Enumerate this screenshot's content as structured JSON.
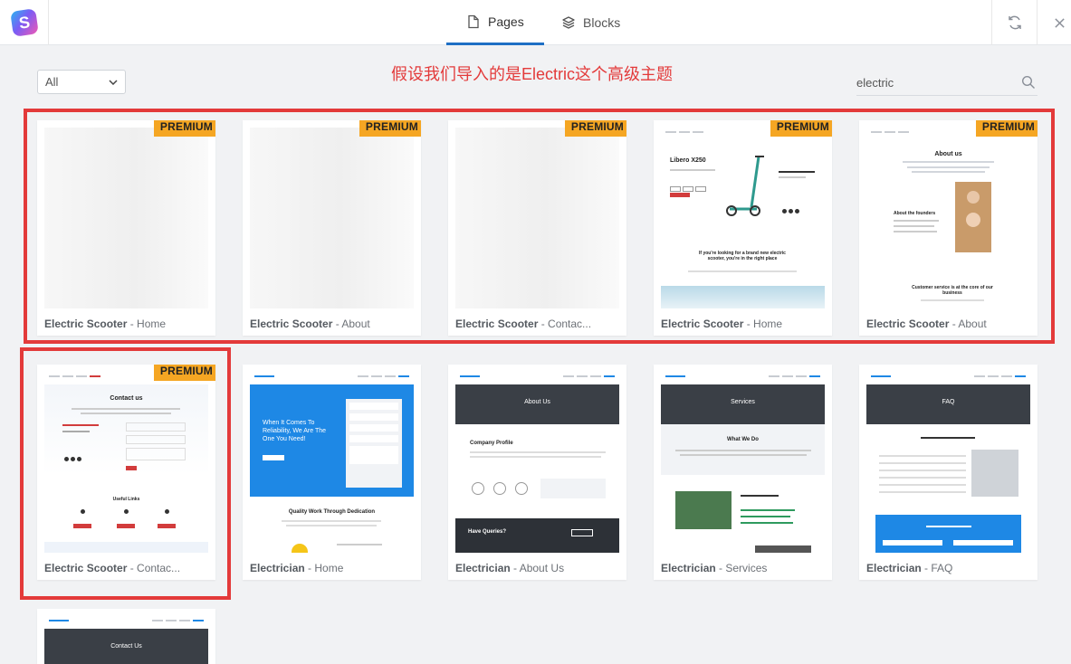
{
  "header": {
    "tabs": [
      {
        "label": "Pages",
        "icon": "page-icon",
        "active": true
      },
      {
        "label": "Blocks",
        "icon": "layers-icon",
        "active": false
      }
    ],
    "refresh_icon": "refresh-icon",
    "close_icon": "close-icon"
  },
  "toolbar": {
    "filter_selected": "All",
    "search_value": "electric",
    "search_icon": "search-icon"
  },
  "annotation": "假设我们导入的是Electric这个高级主题",
  "premium_label": "PREMIUM",
  "cards": [
    {
      "kit": "Electric Scooter",
      "page": " - Home",
      "premium": true
    },
    {
      "kit": "Electric Scooter",
      "page": " - About",
      "premium": true
    },
    {
      "kit": "Electric Scooter",
      "page": " - Contac...",
      "premium": true
    },
    {
      "kit": "Electric Scooter",
      "page": " - Home",
      "premium": true
    },
    {
      "kit": "Electric Scooter",
      "page": " - About",
      "premium": true
    },
    {
      "kit": "Electric Scooter",
      "page": " - Contac...",
      "premium": true
    },
    {
      "kit": "Electrician",
      "page": " - Home",
      "premium": false
    },
    {
      "kit": "Electrician",
      "page": " - About Us",
      "premium": false
    },
    {
      "kit": "Electrician",
      "page": " - Services",
      "premium": false
    },
    {
      "kit": "Electrician",
      "page": " - FAQ",
      "premium": false
    },
    {
      "kit": "",
      "page": "",
      "premium": false
    }
  ],
  "thumbs": {
    "scooter_home": {
      "title": "Libero X250",
      "text": "If you're looking for a brand new electric scooter, you're in the right place"
    },
    "scooter_about": {
      "title": "About us",
      "sub": "About the founders",
      "text": "Customer service is at the core of our business"
    },
    "scooter_contact": {
      "title": "Contact us",
      "sub": "Useful Links"
    },
    "elec_home": {
      "title": "When It Comes To Reliability, We Are The One You Need!",
      "sub": "Quality Work Through Dedication"
    },
    "elec_about": {
      "title": "About Us",
      "sub": "Company Profile",
      "text": "Have Queries?"
    },
    "elec_services": {
      "title": "Services",
      "sub": "What We Do"
    },
    "elec_faq": {
      "title": "FAQ"
    },
    "elec_contact": {
      "title": "Contact Us"
    }
  },
  "colors": {
    "accent": "#1e6fc5",
    "premium": "#f5a623",
    "highlight": "#e33a3a"
  }
}
